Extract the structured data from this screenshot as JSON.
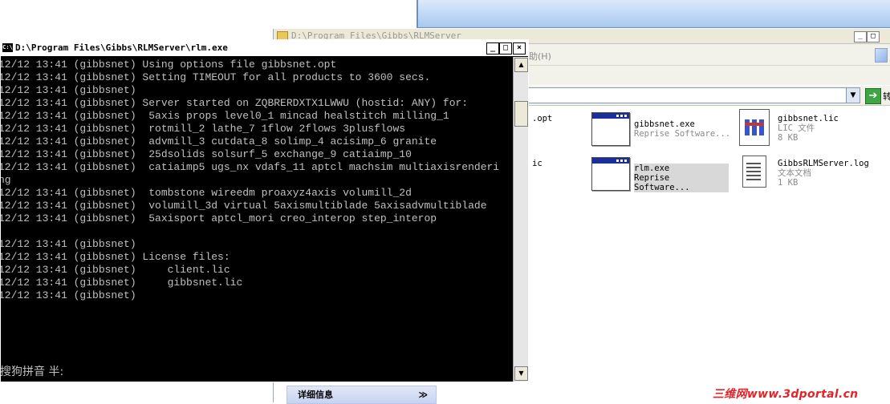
{
  "explorer": {
    "title": "D:\\Program Files\\Gibbs\\RLMServer",
    "menu_help": "助(H)",
    "go_label": "转",
    "details_label": "详细信息",
    "details_chevron": "≫",
    "files": [
      {
        "name": ".opt"
      },
      {
        "name": "gibbsnet.exe",
        "sub": "Reprise Software..."
      },
      {
        "name": "gibbsnet.lic",
        "sub1": "LIC 文件",
        "sub2": "8 KB"
      },
      {
        "name": "ic"
      },
      {
        "name": "rlm.exe",
        "sub": "Reprise Software..."
      },
      {
        "name": "GibbsRLMServer.log",
        "sub1": "文本文档",
        "sub2": "1 KB"
      }
    ]
  },
  "console": {
    "title": "D:\\Program Files\\Gibbs\\RLMServer\\rlm.exe",
    "buttons": {
      "minimize": "_",
      "maximize": "□",
      "close": "×"
    },
    "lines": [
      "12/12 13:41 (gibbsnet) Using options file gibbsnet.opt",
      "12/12 13:41 (gibbsnet) Setting TIMEOUT for all products to 3600 secs.",
      "12/12 13:41 (gibbsnet)",
      "12/12 13:41 (gibbsnet) Server started on ZQBRERDXTX1LWWU (hostid: ANY) for:",
      "12/12 13:41 (gibbsnet)  5axis props level0_1 mincad healstitch milling_1",
      "12/12 13:41 (gibbsnet)  rotmill_2 lathe_7 1flow 2flows 3plusflows",
      "12/12 13:41 (gibbsnet)  advmill_3 cutdata_8 solimp_4 acisimp_6 granite",
      "12/12 13:41 (gibbsnet)  25dsolids solsurf_5 exchange_9 catiaimp_10",
      "12/12 13:41 (gibbsnet)  catiaimp5 ugs_nx vdafs_11 aptcl machsim multiaxisrenderi",
      "ng",
      "12/12 13:41 (gibbsnet)  tombstone wireedm proaxyz4axis volumill_2d",
      "12/12 13:41 (gibbsnet)  volumill_3d virtual 5axismultiblade 5axisadvmultiblade",
      "12/12 13:41 (gibbsnet)  5axisport aptcl_mori creo_interop step_interop",
      "",
      "12/12 13:41 (gibbsnet)",
      "12/12 13:41 (gibbsnet) License files:",
      "12/12 13:41 (gibbsnet)     client.lic",
      "12/12 13:41 (gibbsnet)     gibbsnet.lic",
      "12/12 13:41 (gibbsnet)"
    ],
    "ime_status": "搜狗拼音 半:"
  },
  "watermark": "三维网www.3dportal.cn"
}
